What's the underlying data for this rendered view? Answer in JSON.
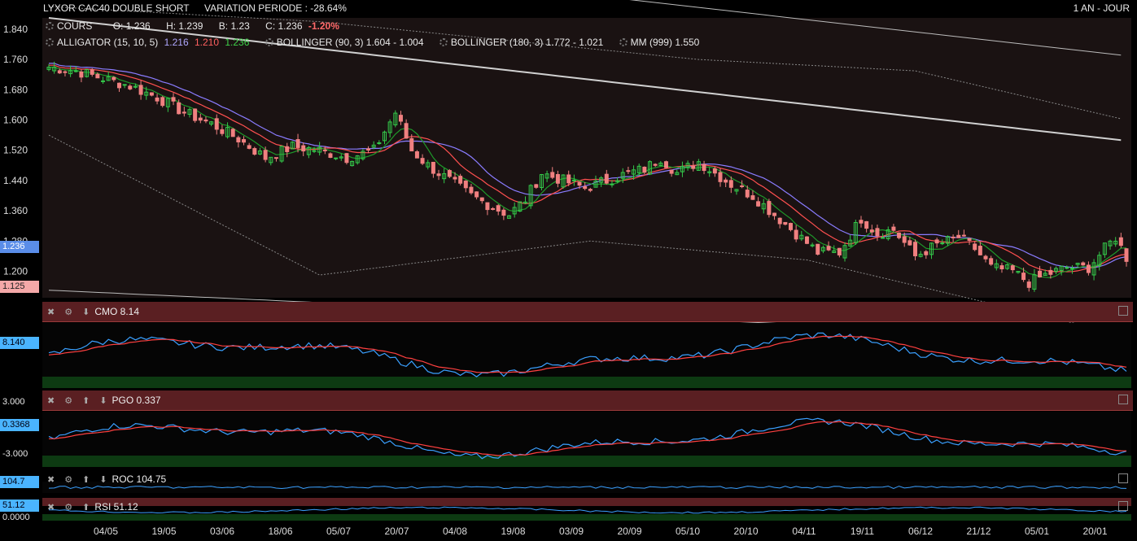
{
  "header": {
    "name": "LYXOR CAC40 DOUBLE SHORT",
    "variation": "VARIATION PERIODE : -28.64%",
    "period": "1 AN - JOUR"
  },
  "legend": {
    "cours": "COURS",
    "open": "O: 1.236",
    "high": "H: 1.239",
    "low": "B: 1.23",
    "close": "C: 1.236",
    "change": "-1.20%",
    "alligator": "ALLIGATOR (15, 10, 5)",
    "alligator_v1": "1.216",
    "alligator_v2": "1.210",
    "alligator_v3": "1.236",
    "bollinger1": "BOLLINGER (90, 3) 1.604 - 1.004",
    "bollinger2": "BOLLINGER (180, 3) 1.772 - 1.021",
    "mm": "MM (999) 1.550"
  },
  "price_labels": {
    "current": "1.236",
    "low": "1.125"
  },
  "panels": {
    "cmo": {
      "title": "CMO 8.14",
      "value": "8.140"
    },
    "pgo": {
      "title": "PGO 0.337",
      "value": "0.3368",
      "top": "3.000",
      "bottom": "-3.000"
    },
    "roc": {
      "title": "ROC 104.75",
      "value": "104.7"
    },
    "rsi": {
      "title": "RSI 51.12",
      "value": "51.12",
      "bottom": "0.0000"
    }
  },
  "colors": {
    "bg": "#1a1212",
    "up": "#34c94a",
    "down": "#f08080",
    "alligator_green": "#1e9a2a",
    "alligator_red": "#ff5050",
    "alligator_blue": "#8a7cff",
    "mm": "#d0d0d0",
    "indicator": "#3aa0ff",
    "signal": "#ff4040"
  },
  "chart_data": {
    "type": "candlestick",
    "yticks": [
      "1.840",
      "1.760",
      "1.680",
      "1.600",
      "1.520",
      "1.440",
      "1.360",
      "1.280",
      "1.200"
    ],
    "ylim": [
      1.13,
      1.87
    ],
    "xticks": [
      "04/05",
      "19/05",
      "03/06",
      "18/06",
      "05/07",
      "20/07",
      "04/08",
      "19/08",
      "03/09",
      "20/09",
      "05/10",
      "20/10",
      "04/11",
      "19/11",
      "06/12",
      "21/12",
      "05/01",
      "20/01"
    ],
    "close_path": [
      [
        0,
        1.74
      ],
      [
        5,
        1.73
      ],
      [
        10,
        1.71
      ],
      [
        15,
        1.69
      ],
      [
        20,
        1.66
      ],
      [
        25,
        1.62
      ],
      [
        30,
        1.59
      ],
      [
        35,
        1.55
      ],
      [
        40,
        1.5
      ],
      [
        45,
        1.53
      ],
      [
        50,
        1.52
      ],
      [
        55,
        1.5
      ],
      [
        60,
        1.52
      ],
      [
        64,
        1.62
      ],
      [
        67,
        1.52
      ],
      [
        70,
        1.48
      ],
      [
        74,
        1.44
      ],
      [
        78,
        1.4
      ],
      [
        82,
        1.37
      ],
      [
        85,
        1.35
      ],
      [
        88,
        1.39
      ],
      [
        91,
        1.46
      ],
      [
        95,
        1.44
      ],
      [
        99,
        1.42
      ],
      [
        103,
        1.44
      ],
      [
        107,
        1.46
      ],
      [
        110,
        1.47
      ],
      [
        113,
        1.5
      ],
      [
        116,
        1.46
      ],
      [
        120,
        1.49
      ],
      [
        123,
        1.46
      ],
      [
        126,
        1.43
      ],
      [
        130,
        1.4
      ],
      [
        134,
        1.35
      ],
      [
        138,
        1.3
      ],
      [
        142,
        1.25
      ],
      [
        146,
        1.25
      ],
      [
        150,
        1.34
      ],
      [
        153,
        1.3
      ],
      [
        156,
        1.31
      ],
      [
        160,
        1.24
      ],
      [
        164,
        1.27
      ],
      [
        168,
        1.29
      ],
      [
        171,
        1.26
      ],
      [
        174,
        1.21
      ],
      [
        178,
        1.2
      ],
      [
        181,
        1.17
      ],
      [
        184,
        1.19
      ],
      [
        188,
        1.21
      ],
      [
        192,
        1.21
      ],
      [
        195,
        1.26
      ],
      [
        197,
        1.29
      ],
      [
        199,
        1.236
      ]
    ],
    "mm999": [
      [
        0,
        1.87
      ],
      [
        199,
        1.545
      ]
    ],
    "boll_upper": [
      [
        0,
        1.9
      ],
      [
        50,
        1.86
      ],
      [
        120,
        1.76
      ],
      [
        160,
        1.73
      ],
      [
        199,
        1.6
      ]
    ],
    "boll_lower": [
      [
        0,
        1.56
      ],
      [
        50,
        1.19
      ],
      [
        100,
        1.28
      ],
      [
        140,
        1.23
      ],
      [
        199,
        1.03
      ]
    ],
    "boll2_upper": [
      [
        0,
        1.98
      ],
      [
        100,
        1.93
      ],
      [
        199,
        1.77
      ]
    ],
    "boll2_lower": [
      [
        0,
        1.15
      ],
      [
        199,
        1.02
      ]
    ]
  }
}
